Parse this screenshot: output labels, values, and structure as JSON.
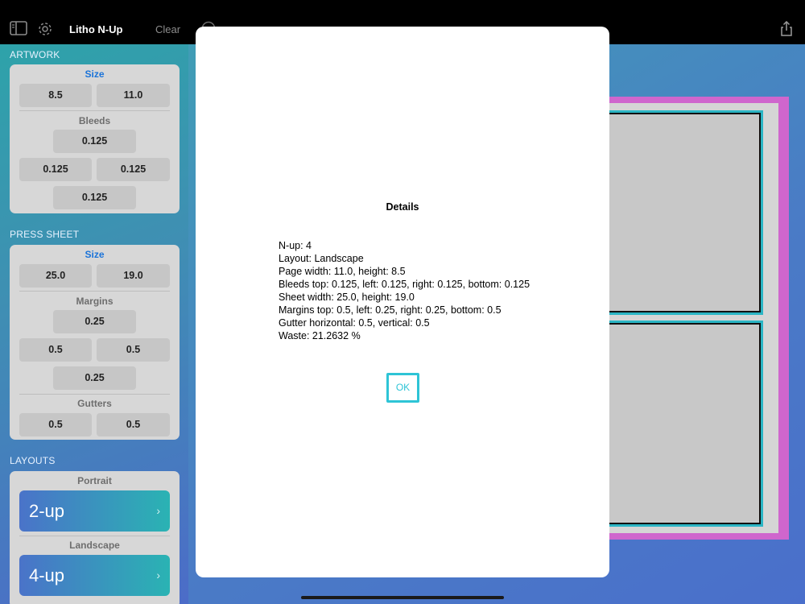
{
  "app": {
    "title": "Litho N-Up",
    "clear_label": "Clear",
    "sidebar_icon": "sidebar-toggle-icon",
    "settings_icon": "gear-icon",
    "share_icon": "share-icon"
  },
  "artwork": {
    "header": "ARTWORK",
    "size_title": "Size",
    "width": "8.5",
    "height": "11.0",
    "bleeds_title": "Bleeds",
    "bleed_top": "0.125",
    "bleed_left": "0.125",
    "bleed_right": "0.125",
    "bleed_bottom": "0.125"
  },
  "press_sheet": {
    "header": "PRESS SHEET",
    "size_title": "Size",
    "width": "25.0",
    "height": "19.0",
    "margins_title": "Margins",
    "margin_top": "0.25",
    "margin_left": "0.5",
    "margin_right": "0.5",
    "margin_bottom": "0.25",
    "gutters_title": "Gutters",
    "gutter_horizontal": "0.5",
    "gutter_vertical": "0.5"
  },
  "layouts": {
    "header": "LAYOUTS",
    "portrait_title": "Portrait",
    "portrait_value": "2-up",
    "landscape_title": "Landscape",
    "landscape_value": "4-up"
  },
  "dialog": {
    "title": "Details",
    "lines": [
      "N-up: 4",
      "Layout: Landscape",
      "Page width: 11.0, height: 8.5",
      "Bleeds top: 0.125, left: 0.125, right: 0.125, bottom: 0.125",
      "Sheet width: 25.0, height: 19.0",
      "Margins top: 0.5, left: 0.25, right: 0.25, bottom: 0.5",
      "Gutter horizontal: 0.5, vertical: 0.5",
      "Waste: 21.2632 %"
    ],
    "ok_label": "OK"
  },
  "colors": {
    "accent_blue": "#1a73d9",
    "ok_cyan": "#2ec4d6",
    "sheet_magenta": "#cf66cd"
  }
}
